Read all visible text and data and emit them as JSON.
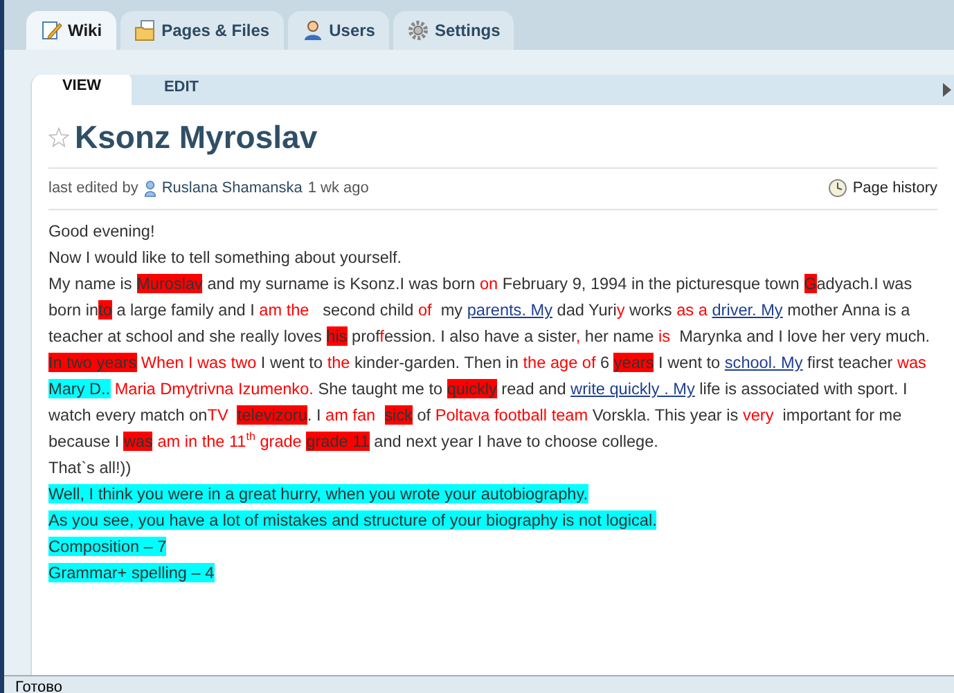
{
  "tabs": [
    {
      "label": "Wiki",
      "selected": true,
      "kind": "wiki"
    },
    {
      "label": "Pages & Files",
      "selected": false,
      "kind": "files"
    },
    {
      "label": "Users",
      "selected": false,
      "kind": "users"
    },
    {
      "label": "Settings",
      "selected": false,
      "kind": "settings"
    }
  ],
  "subtabs": [
    {
      "label": "VIEW",
      "selected": true
    },
    {
      "label": "EDIT",
      "selected": false
    }
  ],
  "page": {
    "title": "Ksonz Myroslav",
    "starred": false,
    "edited_prefix": "last edited by",
    "editor": "Ruslana Shamanska",
    "edited_time": "1 wk ago",
    "history": "Page history"
  },
  "paragraphs": [
    [
      {
        "kind": "plain",
        "text": "Good evening!"
      }
    ],
    [
      {
        "kind": "plain",
        "text": "Now I would like to tell something about yourself."
      }
    ],
    [
      {
        "kind": "plain",
        "text": "My name is "
      },
      {
        "kind": "hl",
        "text": "Muroslav"
      },
      {
        "kind": "plain",
        "text": " and my surname is Ksonz.I was born "
      },
      {
        "kind": "red",
        "text": "on"
      },
      {
        "kind": "plain",
        "text": " February 9, 1994 in the picturesque town "
      },
      {
        "kind": "hl",
        "text": "G"
      },
      {
        "kind": "plain",
        "text": "adyach.I was born in"
      },
      {
        "kind": "hl",
        "text": "to"
      },
      {
        "kind": "plain",
        "text": " a large family and I "
      },
      {
        "kind": "red",
        "text": "am the"
      },
      {
        "kind": "plain",
        "text": "   second child "
      },
      {
        "kind": "red",
        "text": "of"
      },
      {
        "kind": "plain",
        "text": "  my "
      },
      {
        "kind": "link",
        "text": "parents. My"
      },
      {
        "kind": "plain",
        "text": " dad Yuri"
      },
      {
        "kind": "red",
        "text": "y"
      },
      {
        "kind": "plain",
        "text": " works "
      },
      {
        "kind": "red",
        "text": "as a "
      },
      {
        "kind": "link",
        "text": "driver. My"
      },
      {
        "kind": "plain",
        "text": " mother Anna is a teacher at school and she really loves "
      },
      {
        "kind": "hl",
        "text": "his"
      },
      {
        "kind": "plain",
        "text": " prof"
      },
      {
        "kind": "red",
        "text": "f"
      },
      {
        "kind": "plain",
        "text": "ession. I also have a sister"
      },
      {
        "kind": "red",
        "text": ","
      },
      {
        "kind": "plain",
        "text": " her name "
      },
      {
        "kind": "red",
        "text": "is"
      },
      {
        "kind": "plain",
        "text": "  Marynka and I love her very much."
      }
    ],
    [
      {
        "kind": "hl",
        "text": "In two years"
      },
      {
        "kind": "red",
        "text": " When I was two"
      },
      {
        "kind": "plain",
        "text": " I went to "
      },
      {
        "kind": "red",
        "text": "the"
      },
      {
        "kind": "plain",
        "text": " kinder-garden. Then in "
      },
      {
        "kind": "red",
        "text": "the age of"
      },
      {
        "kind": "plain",
        "text": " 6 "
      },
      {
        "kind": "hl",
        "text": "years"
      },
      {
        "kind": "plain",
        "text": " I went to "
      },
      {
        "kind": "link",
        "text": "school. My"
      },
      {
        "kind": "plain",
        "text": " first teacher "
      },
      {
        "kind": "red",
        "text": "was  "
      },
      {
        "kind": "cyan",
        "text": "Mary D.."
      },
      {
        "kind": "red",
        "text": " Maria Dmytrivna Izumenko."
      },
      {
        "kind": "plain",
        "text": " She taught me to "
      },
      {
        "kind": "hl",
        "text": "quickly"
      },
      {
        "kind": "plain",
        "text": " read and "
      },
      {
        "kind": "link",
        "text": "write quickly . My"
      },
      {
        "kind": "plain",
        "text": " life is associated with sport. I watch every match on"
      },
      {
        "kind": "red",
        "text": "TV  "
      },
      {
        "kind": "hl",
        "text": "televizoru"
      },
      {
        "kind": "plain",
        "text": ". I "
      },
      {
        "kind": "red",
        "text": "am fan  "
      },
      {
        "kind": "hl",
        "text": "sick"
      },
      {
        "kind": "plain",
        "text": " of "
      },
      {
        "kind": "red",
        "text": "Poltava football team"
      },
      {
        "kind": "plain",
        "text": " Vorskla. This year is "
      },
      {
        "kind": "red",
        "text": "very"
      },
      {
        "kind": "plain",
        "text": "  important for me because I "
      },
      {
        "kind": "hl",
        "text": "was"
      },
      {
        "kind": "red",
        "text": " am in the 11$^{th}$ grade "
      },
      {
        "kind": "hl",
        "text": "grade 11"
      },
      {
        "kind": "plain",
        "text": " and next year I have to choose college."
      }
    ],
    [
      {
        "kind": "plain",
        "text": "That`s all!))"
      }
    ],
    [
      {
        "kind": "cyan",
        "text": "Well, I think you were in a great hurry, when you wrote your autobiography."
      }
    ],
    [
      {
        "kind": "cyan",
        "text": "As you see, you have a lot of mistakes and structure of your biography is not logical."
      }
    ],
    [
      {
        "kind": "cyan",
        "text": "Composition – 7"
      }
    ],
    [
      {
        "kind": "cyan",
        "text": "Grammar+ spelling – 4"
      }
    ]
  ],
  "status_bar": "Готово"
}
